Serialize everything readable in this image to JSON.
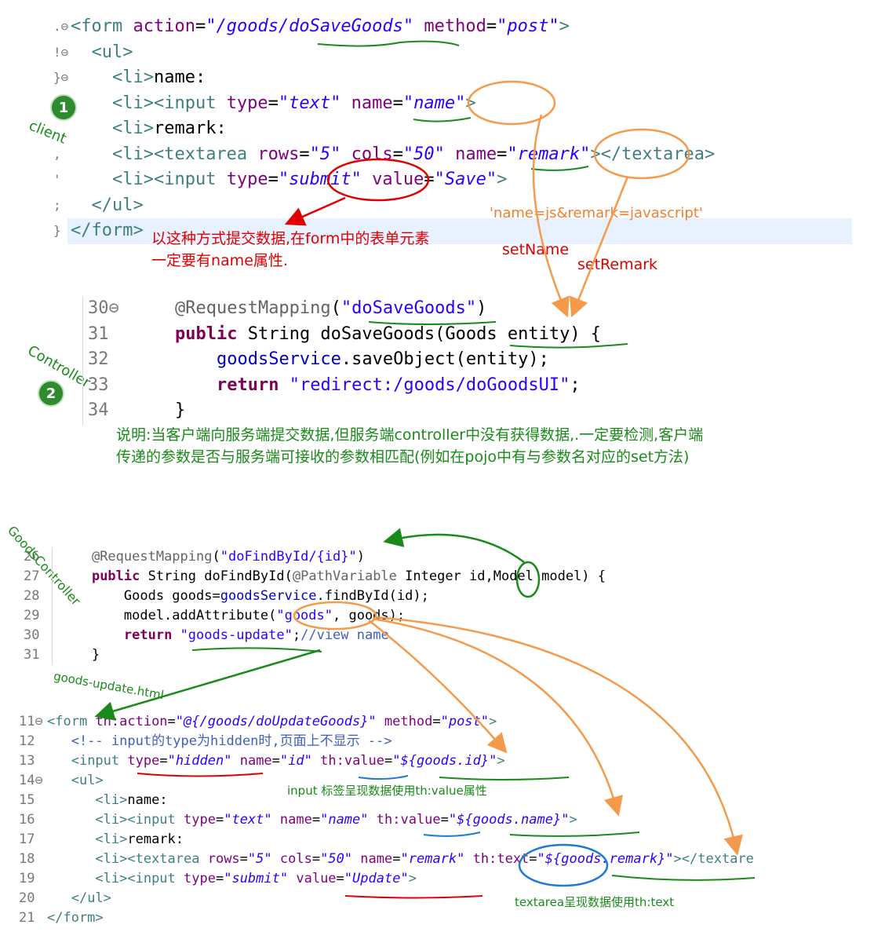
{
  "section1": {
    "lines": [
      {
        "marker": ".",
        "fold": true,
        "segments": [
          {
            "c": "tag",
            "t": "<form "
          },
          {
            "c": "attr",
            "t": "action"
          },
          {
            "c": "txt",
            "t": "="
          },
          {
            "c": "str",
            "t": "\"/goods/doSaveGoods\""
          },
          {
            "c": "txt",
            "t": " "
          },
          {
            "c": "attr",
            "t": "method"
          },
          {
            "c": "txt",
            "t": "="
          },
          {
            "c": "str",
            "t": "\"post\""
          },
          {
            "c": "tag",
            "t": ">"
          }
        ]
      },
      {
        "marker": "!",
        "fold": true,
        "segments": [
          {
            "c": "txt",
            "t": "  "
          },
          {
            "c": "tag",
            "t": "<ul>"
          }
        ]
      },
      {
        "marker": "}",
        "fold": true,
        "segments": [
          {
            "c": "txt",
            "t": "    "
          },
          {
            "c": "tag",
            "t": "<li>"
          },
          {
            "c": "txt",
            "t": "name:"
          }
        ]
      },
      {
        "marker": "",
        "fold": false,
        "segments": [
          {
            "c": "txt",
            "t": "    "
          },
          {
            "c": "tag",
            "t": "<li><input "
          },
          {
            "c": "attr",
            "t": "type"
          },
          {
            "c": "txt",
            "t": "="
          },
          {
            "c": "str",
            "t": "\"text\""
          },
          {
            "c": "txt",
            "t": " "
          },
          {
            "c": "attr",
            "t": "name"
          },
          {
            "c": "txt",
            "t": "="
          },
          {
            "c": "str",
            "t": "\"name\""
          },
          {
            "c": "tag",
            "t": ">"
          }
        ]
      },
      {
        "marker": "",
        "fold": false,
        "segments": [
          {
            "c": "txt",
            "t": "    "
          },
          {
            "c": "tag",
            "t": "<li>"
          },
          {
            "c": "txt",
            "t": "remark:"
          }
        ]
      },
      {
        "marker": ",",
        "fold": false,
        "segments": [
          {
            "c": "txt",
            "t": "    "
          },
          {
            "c": "tag",
            "t": "<li><textarea "
          },
          {
            "c": "attr",
            "t": "rows"
          },
          {
            "c": "txt",
            "t": "="
          },
          {
            "c": "str",
            "t": "\"5\""
          },
          {
            "c": "txt",
            "t": " "
          },
          {
            "c": "attr",
            "t": "cols"
          },
          {
            "c": "txt",
            "t": "="
          },
          {
            "c": "str",
            "t": "\"50\""
          },
          {
            "c": "txt",
            "t": " "
          },
          {
            "c": "attr",
            "t": "name"
          },
          {
            "c": "txt",
            "t": "="
          },
          {
            "c": "str",
            "t": "\"remark\""
          },
          {
            "c": "tag",
            "t": "></textarea>"
          }
        ]
      },
      {
        "marker": "'",
        "fold": false,
        "segments": [
          {
            "c": "txt",
            "t": "    "
          },
          {
            "c": "tag",
            "t": "<li><input "
          },
          {
            "c": "attr",
            "t": "type"
          },
          {
            "c": "txt",
            "t": "="
          },
          {
            "c": "str",
            "t": "\"submit\""
          },
          {
            "c": "txt",
            "t": " "
          },
          {
            "c": "attr",
            "t": "value"
          },
          {
            "c": "txt",
            "t": "="
          },
          {
            "c": "str",
            "t": "\"Save\""
          },
          {
            "c": "tag",
            "t": ">"
          }
        ]
      },
      {
        "marker": ";",
        "fold": false,
        "segments": [
          {
            "c": "txt",
            "t": "  "
          },
          {
            "c": "tag",
            "t": "</ul>"
          }
        ]
      },
      {
        "marker": "}",
        "fold": false,
        "segments": [
          {
            "c": "tag",
            "t": "</form>"
          }
        ]
      }
    ],
    "badge": "1",
    "label_client": "client",
    "note_red_line1": "以这种方式提交数据,在form中的表单元素",
    "note_red_line2": "一定要有name属性.",
    "query_string": "'name=js&remark=javascript'",
    "set_name": "setName",
    "set_remark": "setRemark"
  },
  "section2": {
    "lines": [
      {
        "num": "30",
        "fold": true,
        "segments": [
          {
            "c": "txt",
            "t": "    "
          },
          {
            "c": "ann",
            "t": "@RequestMapping"
          },
          {
            "c": "txt",
            "t": "("
          },
          {
            "c": "jstr",
            "t": "\"doSaveGoods\""
          },
          {
            "c": "txt",
            "t": ")"
          }
        ]
      },
      {
        "num": "31",
        "fold": false,
        "segments": [
          {
            "c": "txt",
            "t": "    "
          },
          {
            "c": "kw",
            "t": "public"
          },
          {
            "c": "txt",
            "t": " String doSaveGoods(Goods entity) {"
          }
        ]
      },
      {
        "num": "32",
        "fold": false,
        "segments": [
          {
            "c": "txt",
            "t": "        "
          },
          {
            "c": "fld",
            "t": "goodsService"
          },
          {
            "c": "txt",
            "t": ".saveObject(entity);"
          }
        ]
      },
      {
        "num": "33",
        "fold": false,
        "segments": [
          {
            "c": "txt",
            "t": "        "
          },
          {
            "c": "kw",
            "t": "return"
          },
          {
            "c": "txt",
            "t": " "
          },
          {
            "c": "jstr",
            "t": "\"redirect:/goods/doGoodsUI\""
          },
          {
            "c": "txt",
            "t": ";"
          }
        ]
      },
      {
        "num": "34",
        "fold": false,
        "segments": [
          {
            "c": "txt",
            "t": "    }"
          }
        ]
      }
    ],
    "badge": "2",
    "label_controller": "Controller",
    "note_line1": "说明:当客户端向服务端提交数据,但服务端controller中没有获得数据,.一定要检测,客户端",
    "note_line2": "传递的参数是否与服务端可接收的参数相匹配(例如在pojo中有与参数名对应的set方法)"
  },
  "section3": {
    "label_controller": "GoodsController",
    "lines": [
      {
        "num": "26",
        "fold": false,
        "segments": [
          {
            "c": "txt",
            "t": "    "
          },
          {
            "c": "ann",
            "t": "@RequestMapping"
          },
          {
            "c": "txt",
            "t": "("
          },
          {
            "c": "jstr",
            "t": "\"doFindById/{id}\""
          },
          {
            "c": "txt",
            "t": ")"
          }
        ]
      },
      {
        "num": "27",
        "fold": false,
        "segments": [
          {
            "c": "txt",
            "t": "    "
          },
          {
            "c": "kw",
            "t": "public"
          },
          {
            "c": "txt",
            "t": " String doFindById("
          },
          {
            "c": "ann",
            "t": "@PathVariable"
          },
          {
            "c": "txt",
            "t": " Integer id,Model model) {"
          }
        ]
      },
      {
        "num": "28",
        "fold": false,
        "segments": [
          {
            "c": "txt",
            "t": "        Goods goods="
          },
          {
            "c": "fld",
            "t": "goodsService"
          },
          {
            "c": "txt",
            "t": ".findById(id);"
          }
        ]
      },
      {
        "num": "29",
        "fold": false,
        "segments": [
          {
            "c": "txt",
            "t": "        model.addAttribute("
          },
          {
            "c": "jstr",
            "t": "\"goods\""
          },
          {
            "c": "txt",
            "t": ", goods);"
          }
        ]
      },
      {
        "num": "30",
        "fold": false,
        "segments": [
          {
            "c": "txt",
            "t": "        "
          },
          {
            "c": "kw",
            "t": "return"
          },
          {
            "c": "txt",
            "t": " "
          },
          {
            "c": "jstr",
            "t": "\"goods-update\""
          },
          {
            "c": "txt",
            "t": ";"
          },
          {
            "c": "cmt",
            "t": "//view name"
          }
        ]
      },
      {
        "num": "31",
        "fold": false,
        "segments": [
          {
            "c": "txt",
            "t": "    }"
          }
        ]
      }
    ],
    "label_file": "goods-update.html"
  },
  "section4": {
    "lines": [
      {
        "num": "11",
        "fold": true,
        "segments": [
          {
            "c": "tag",
            "t": "<form "
          },
          {
            "c": "attr",
            "t": "th:action"
          },
          {
            "c": "txt",
            "t": "="
          },
          {
            "c": "str",
            "t": "\"@{/goods/doUpdateGoods}\""
          },
          {
            "c": "txt",
            "t": " "
          },
          {
            "c": "attr",
            "t": "method"
          },
          {
            "c": "txt",
            "t": "="
          },
          {
            "c": "str",
            "t": "\"post\""
          },
          {
            "c": "tag",
            "t": ">"
          }
        ]
      },
      {
        "num": "12",
        "fold": false,
        "segments": [
          {
            "c": "txt",
            "t": "   "
          },
          {
            "c": "cmt",
            "t": "<!-- input的type为hidden时,页面上不显示 -->"
          }
        ]
      },
      {
        "num": "13",
        "fold": false,
        "segments": [
          {
            "c": "txt",
            "t": "   "
          },
          {
            "c": "tag",
            "t": "<input "
          },
          {
            "c": "attr",
            "t": "type"
          },
          {
            "c": "txt",
            "t": "="
          },
          {
            "c": "str",
            "t": "\"hidden\""
          },
          {
            "c": "txt",
            "t": " "
          },
          {
            "c": "attr",
            "t": "name"
          },
          {
            "c": "txt",
            "t": "="
          },
          {
            "c": "str",
            "t": "\"id\""
          },
          {
            "c": "txt",
            "t": " "
          },
          {
            "c": "attr",
            "t": "th:value"
          },
          {
            "c": "txt",
            "t": "="
          },
          {
            "c": "str",
            "t": "\"${goods.id}\""
          },
          {
            "c": "tag",
            "t": ">"
          }
        ]
      },
      {
        "num": "14",
        "fold": true,
        "segments": [
          {
            "c": "txt",
            "t": "   "
          },
          {
            "c": "tag",
            "t": "<ul>"
          }
        ]
      },
      {
        "num": "15",
        "fold": false,
        "segments": [
          {
            "c": "txt",
            "t": "      "
          },
          {
            "c": "tag",
            "t": "<li>"
          },
          {
            "c": "txt",
            "t": "name:"
          }
        ]
      },
      {
        "num": "16",
        "fold": false,
        "segments": [
          {
            "c": "txt",
            "t": "      "
          },
          {
            "c": "tag",
            "t": "<li><input "
          },
          {
            "c": "attr",
            "t": "type"
          },
          {
            "c": "txt",
            "t": "="
          },
          {
            "c": "str",
            "t": "\"text\""
          },
          {
            "c": "txt",
            "t": " "
          },
          {
            "c": "attr",
            "t": "name"
          },
          {
            "c": "txt",
            "t": "="
          },
          {
            "c": "str",
            "t": "\"name\""
          },
          {
            "c": "txt",
            "t": " "
          },
          {
            "c": "attr",
            "t": "th:value"
          },
          {
            "c": "txt",
            "t": "="
          },
          {
            "c": "str",
            "t": "\"${goods.name}\""
          },
          {
            "c": "tag",
            "t": ">"
          }
        ]
      },
      {
        "num": "17",
        "fold": false,
        "segments": [
          {
            "c": "txt",
            "t": "      "
          },
          {
            "c": "tag",
            "t": "<li>"
          },
          {
            "c": "txt",
            "t": "remark:"
          }
        ]
      },
      {
        "num": "18",
        "fold": false,
        "segments": [
          {
            "c": "txt",
            "t": "      "
          },
          {
            "c": "tag",
            "t": "<li><textarea "
          },
          {
            "c": "attr",
            "t": "rows"
          },
          {
            "c": "txt",
            "t": "="
          },
          {
            "c": "str",
            "t": "\"5\""
          },
          {
            "c": "txt",
            "t": " "
          },
          {
            "c": "attr",
            "t": "cols"
          },
          {
            "c": "txt",
            "t": "="
          },
          {
            "c": "str",
            "t": "\"50\""
          },
          {
            "c": "txt",
            "t": " "
          },
          {
            "c": "attr",
            "t": "name"
          },
          {
            "c": "txt",
            "t": "="
          },
          {
            "c": "str",
            "t": "\"remark\""
          },
          {
            "c": "txt",
            "t": " "
          },
          {
            "c": "attr",
            "t": "th:text"
          },
          {
            "c": "txt",
            "t": "="
          },
          {
            "c": "str",
            "t": "\"${goods.remark}\""
          },
          {
            "c": "tag",
            "t": "></textare"
          }
        ]
      },
      {
        "num": "19",
        "fold": false,
        "segments": [
          {
            "c": "txt",
            "t": "      "
          },
          {
            "c": "tag",
            "t": "<li><input "
          },
          {
            "c": "attr",
            "t": "type"
          },
          {
            "c": "txt",
            "t": "="
          },
          {
            "c": "str",
            "t": "\"submit\""
          },
          {
            "c": "txt",
            "t": " "
          },
          {
            "c": "attr",
            "t": "value"
          },
          {
            "c": "txt",
            "t": "="
          },
          {
            "c": "str",
            "t": "\"Update\""
          },
          {
            "c": "tag",
            "t": ">"
          }
        ]
      },
      {
        "num": "20",
        "fold": false,
        "segments": [
          {
            "c": "txt",
            "t": "   "
          },
          {
            "c": "tag",
            "t": "</ul>"
          }
        ]
      },
      {
        "num": "21",
        "fold": false,
        "segments": [
          {
            "c": "tag",
            "t": "</form>"
          }
        ]
      }
    ],
    "note_input": "input 标签呈现数据使用th:value属性",
    "note_textarea": "textarea呈现数据使用th:text"
  },
  "colors": {
    "tag": "#3f7f7f",
    "attr": "#7f007f",
    "string": "#2a00ff",
    "keyword": "#7f0055",
    "annotation": "#646464",
    "orange_arrow": "#f59a4a",
    "green_arrow": "#1a8a1a",
    "red_arrow": "#e00000",
    "blue_circle": "#1a7ad4"
  }
}
